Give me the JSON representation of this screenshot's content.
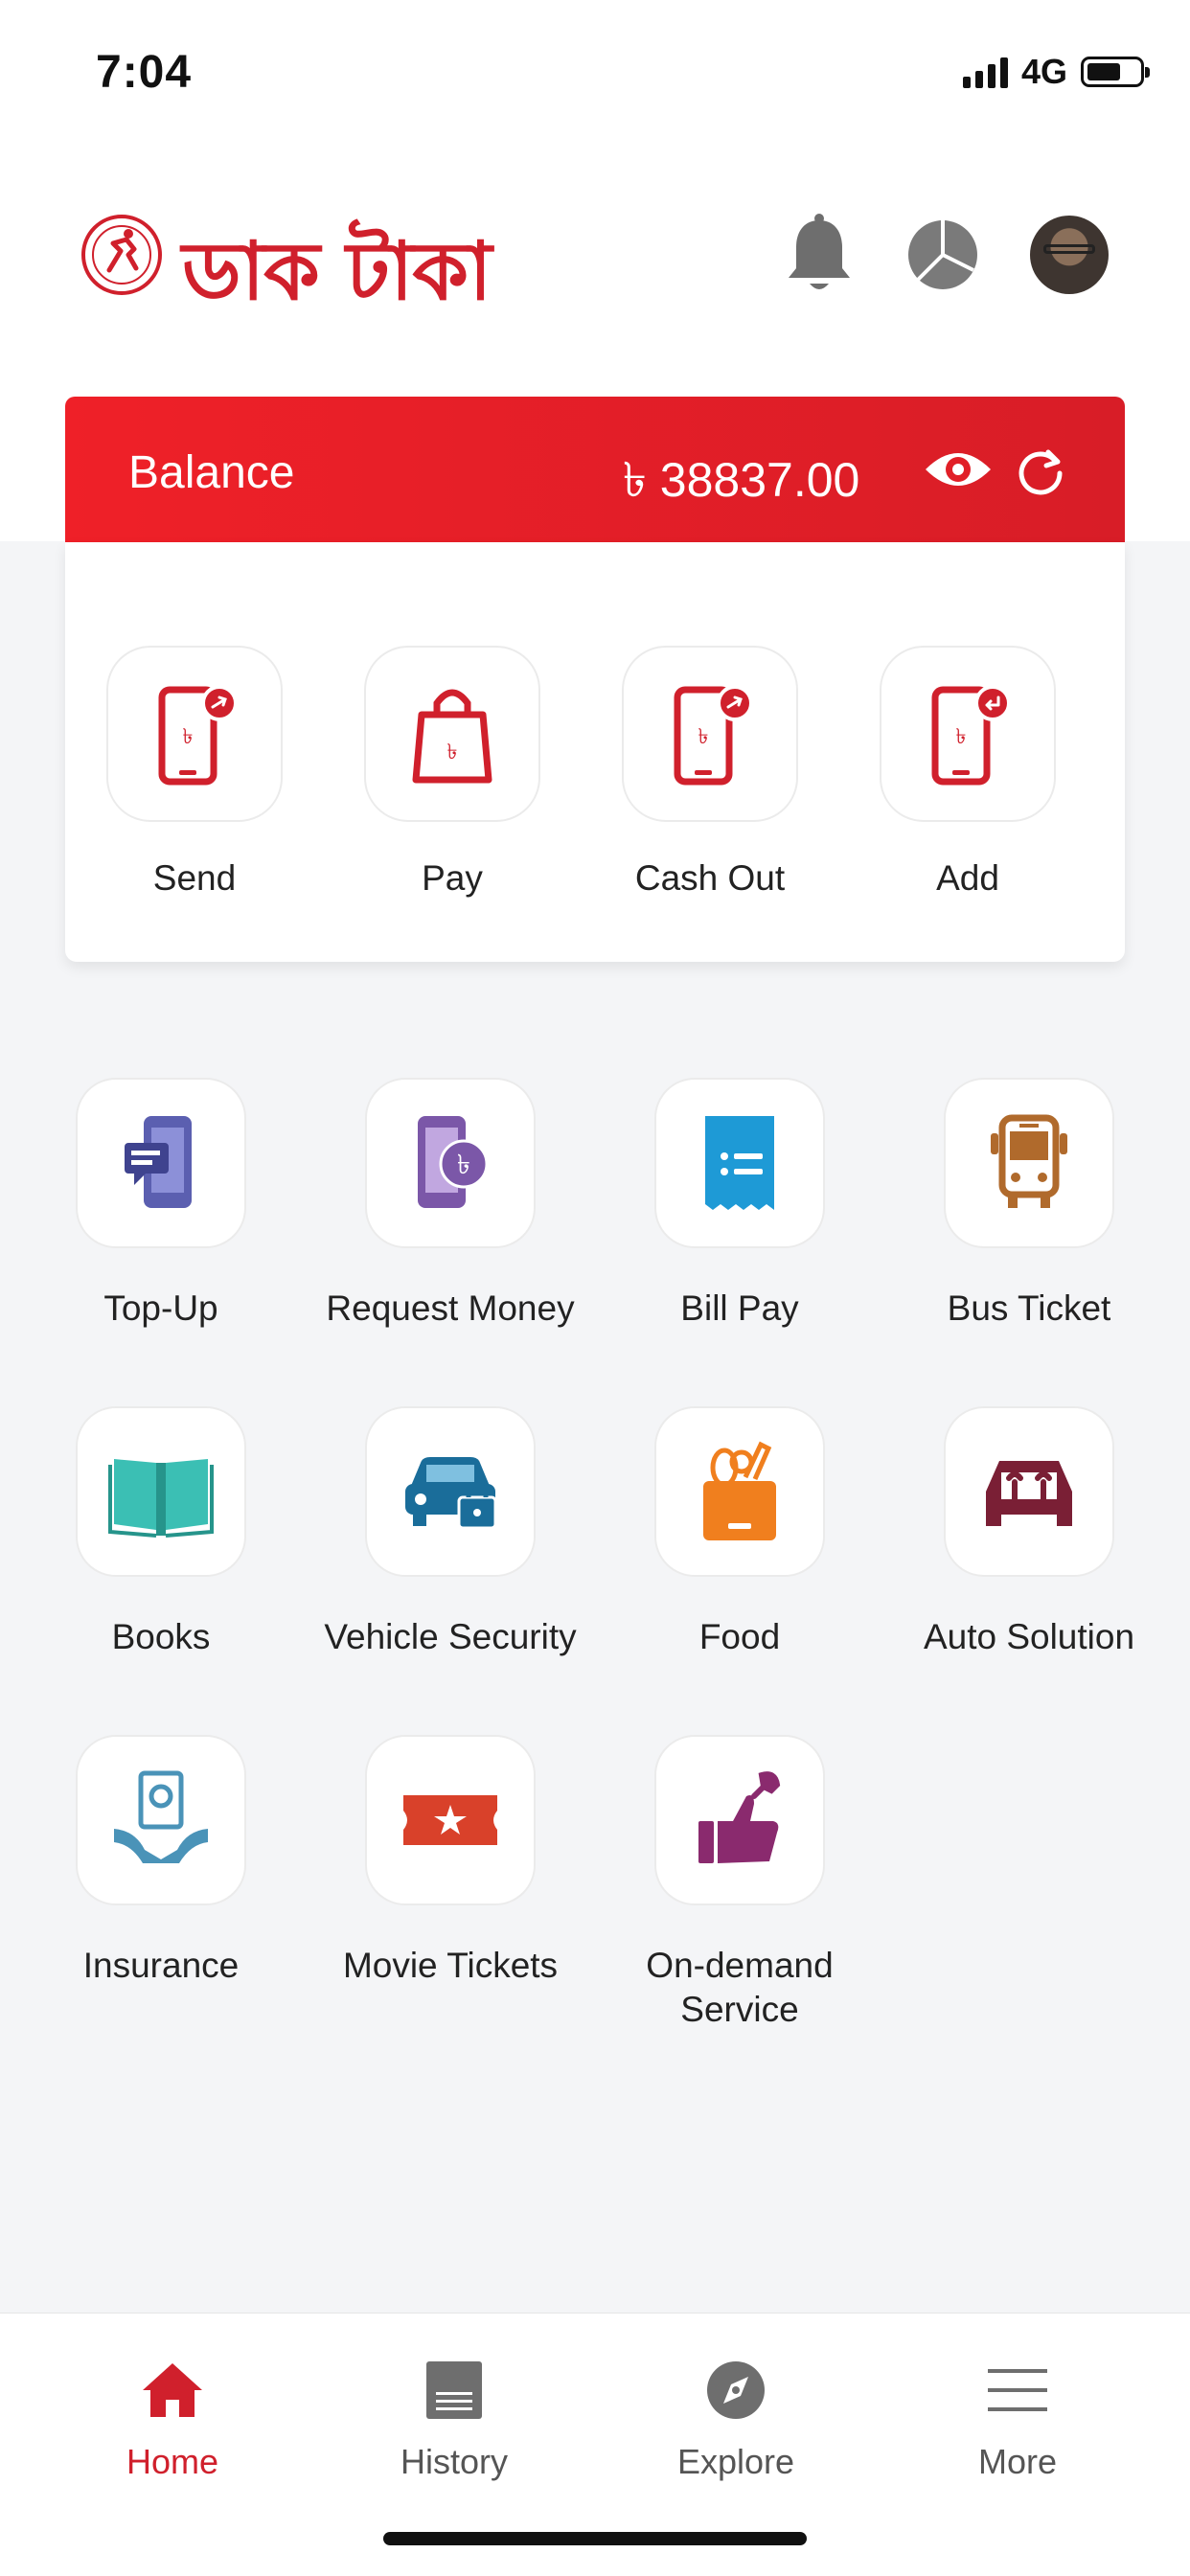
{
  "status_bar": {
    "time": "7:04",
    "network": "4G"
  },
  "header": {
    "brand": "ডাক টাকা"
  },
  "balance": {
    "label": "Balance",
    "amount": "৳ 38837.00"
  },
  "actions": [
    {
      "label": "Send"
    },
    {
      "label": "Pay"
    },
    {
      "label": "Cash Out"
    },
    {
      "label": "Add"
    }
  ],
  "services": [
    {
      "label": "Top-Up"
    },
    {
      "label": "Request Money"
    },
    {
      "label": "Bill Pay"
    },
    {
      "label": "Bus Ticket"
    },
    {
      "label": "Books"
    },
    {
      "label": "Vehicle Security"
    },
    {
      "label": "Food"
    },
    {
      "label": "Auto Solution"
    },
    {
      "label": "Insurance"
    },
    {
      "label": "Movie Tickets"
    },
    {
      "label": "On-demand Service"
    }
  ],
  "bottom_nav": [
    {
      "label": "Home",
      "active": true
    },
    {
      "label": "History"
    },
    {
      "label": "Explore"
    },
    {
      "label": "More"
    }
  ],
  "colors": {
    "brand_red": "#d0202c",
    "balance_red": "#ef2028",
    "topup": "#5b5fb0",
    "request_money": "#7b57a8",
    "bill_pay": "#1e9ad6",
    "bus": "#b06a2c",
    "books": "#3bbfb4",
    "vehicle": "#1a6d9a",
    "food": "#f07f1e",
    "auto": "#7a1f35",
    "insurance": "#4a93b8",
    "movie": "#d9412a",
    "on_demand": "#8a2a6e"
  }
}
